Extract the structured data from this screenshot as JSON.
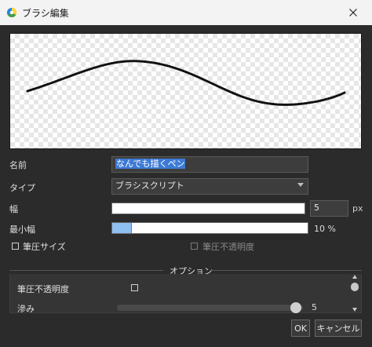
{
  "window": {
    "title": "ブラシ編集",
    "icon": "color-wheel-icon",
    "close_icon": "close-icon"
  },
  "preview": {
    "label": "brush-stroke-preview"
  },
  "form": {
    "name_label": "名前",
    "name_value": "なんでも描くペン",
    "type_label": "タイプ",
    "type_value": "ブラシスクリプト",
    "width_label": "幅",
    "width_value": "5",
    "width_unit": "px",
    "min_width_label": "最小幅",
    "min_width_value": "10 %",
    "min_width_fraction": 0.1,
    "pressure_size_label": "筆圧サイズ",
    "pressure_size_checked": false,
    "pressure_opacity_label": "筆圧不透明度",
    "pressure_opacity_checked": false
  },
  "options": {
    "title": "オプション",
    "pressure_opacity_label": "筆圧不透明度",
    "pressure_opacity_checked": false,
    "bleed_label": "滲み",
    "bleed_value": "5",
    "bleed_fraction": 0.96
  },
  "buttons": {
    "ok": "OK",
    "cancel": "キャンセル"
  },
  "colors": {
    "selection": "#3d7ad6",
    "min_width_fill": "#8ec0f0",
    "dialog_bg": "#2b2b2b"
  }
}
